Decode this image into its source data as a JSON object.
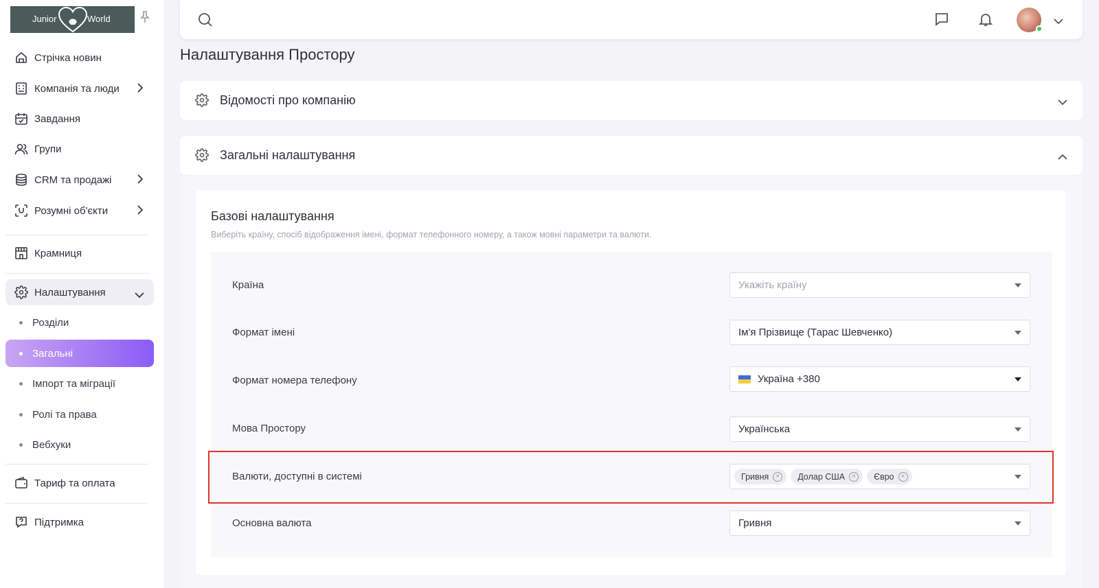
{
  "logo": {
    "left_text": "Junior",
    "right_text": "World"
  },
  "sidebar": {
    "items": [
      {
        "label": "Стрічка новин",
        "icon": "home-icon"
      },
      {
        "label": "Компанія та люди",
        "icon": "building-icon"
      },
      {
        "label": "Завдання",
        "icon": "calendar-icon"
      },
      {
        "label": "Групи",
        "icon": "users-icon"
      },
      {
        "label": "CRM та продажі",
        "icon": "database-icon"
      },
      {
        "label": "Розумні об'єкти",
        "icon": "scan-icon"
      },
      {
        "label": "Крамниця",
        "icon": "store-icon"
      },
      {
        "label": "Налаштування",
        "icon": "settings-icon"
      },
      {
        "label": "Тариф та оплата",
        "icon": "wallet-icon"
      },
      {
        "label": "Підтримка",
        "icon": "help-icon"
      }
    ],
    "settings_sub": [
      "Розділи",
      "Загальні",
      "Імпорт та міграції",
      "Ролі та права",
      "Вебхуки"
    ],
    "selected_sub": "Загальні"
  },
  "page": {
    "title": "Налаштування Простору",
    "panels": [
      "Відомості про компанію",
      "Загальні налаштування"
    ]
  },
  "basic": {
    "title": "Базові налаштування",
    "description": "Виберіть країну, спосіб відображення імені, формат телефонного номеру, а також мовні параметри та валюти.",
    "country_label": "Країна",
    "country_placeholder": "Укажіть країну",
    "name_format_label": "Формат імені",
    "name_format_value": "Ім'я Прізвище (Тарас Шевченко)",
    "phone_format_label": "Формат номера телефону",
    "phone_format_value": "Україна +380",
    "language_label": "Мова Простору",
    "language_value": "Українська",
    "currencies_label": "Валюти, доступні в системі",
    "currencies": [
      "Гривня",
      "Долар США",
      "Євро"
    ],
    "main_currency_label": "Основна валюта",
    "main_currency_value": "Гривня"
  },
  "colors": {
    "accent": "#8b5cf6",
    "highlight": "#e0332a",
    "online": "#3ec46d"
  }
}
